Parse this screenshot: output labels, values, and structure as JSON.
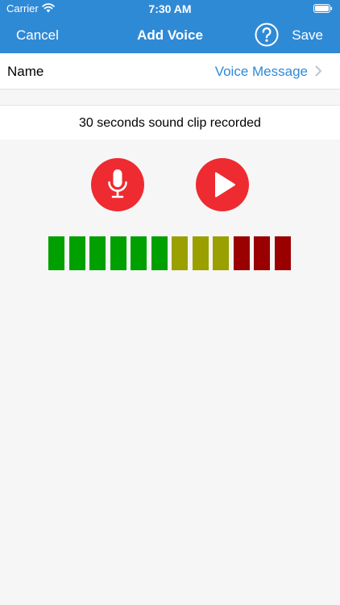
{
  "status_bar": {
    "carrier": "Carrier",
    "time": "7:30 AM",
    "wifi_icon": "wifi-icon",
    "battery_icon": "battery-icon"
  },
  "nav": {
    "cancel_label": "Cancel",
    "title": "Add Voice",
    "help_icon": "question-circle-icon",
    "save_label": "Save"
  },
  "name_row": {
    "label": "Name",
    "value": "Voice Message",
    "chevron_icon": "chevron-right-icon"
  },
  "recording": {
    "status_text": "30 seconds sound clip recorded",
    "record_button_icon": "microphone-icon",
    "play_button_icon": "play-icon"
  },
  "level_meter": {
    "bars": [
      {
        "color": "#00a000"
      },
      {
        "color": "#00a000"
      },
      {
        "color": "#00a000"
      },
      {
        "color": "#00a000"
      },
      {
        "color": "#00a000"
      },
      {
        "color": "#00a000"
      },
      {
        "color": "#9aa000"
      },
      {
        "color": "#9aa000"
      },
      {
        "color": "#9aa000"
      },
      {
        "color": "#9a0000"
      },
      {
        "color": "#9a0000"
      },
      {
        "color": "#9a0000"
      }
    ]
  },
  "colors": {
    "header": "#2f8ad6",
    "accent": "#2f8ad6",
    "record_button": "#ee2b30"
  }
}
